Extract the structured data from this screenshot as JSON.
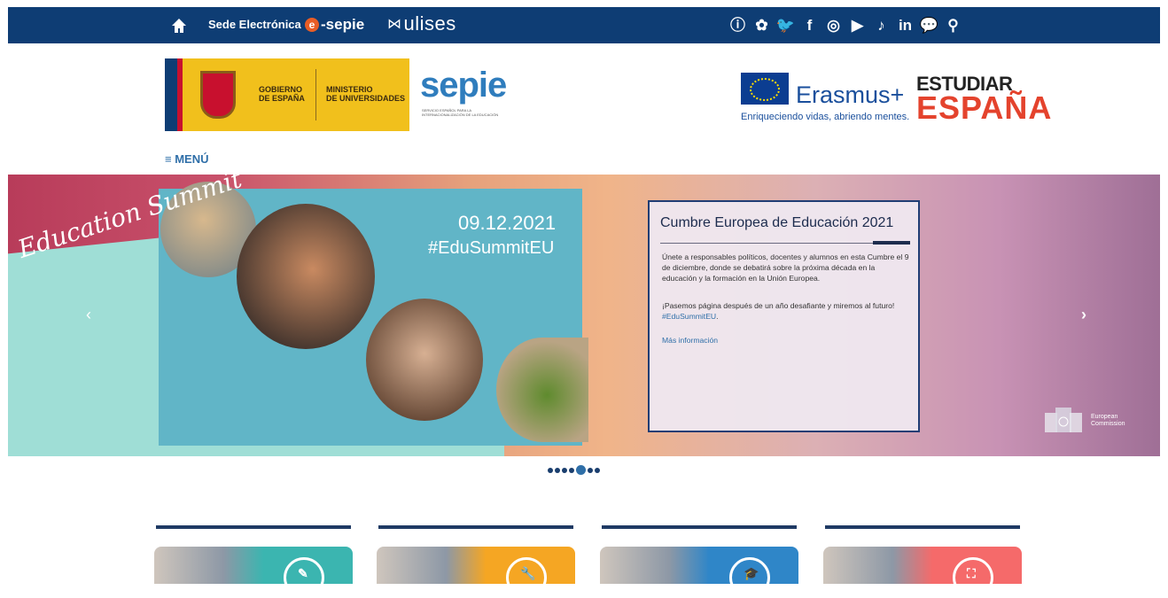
{
  "topbar": {
    "sede_label": "Sede Electrónica",
    "esepie_label": "sepie",
    "esepie_badge": "e",
    "esepie_dash": "-",
    "ulises_label": "ulises",
    "social": [
      {
        "name": "info-icon",
        "glyph": "ⓘ"
      },
      {
        "name": "sepie-icon",
        "glyph": "✿"
      },
      {
        "name": "twitter-icon",
        "glyph": "🐦"
      },
      {
        "name": "facebook-icon",
        "glyph": "f"
      },
      {
        "name": "instagram-icon",
        "glyph": "◎"
      },
      {
        "name": "youtube-icon",
        "glyph": "▶"
      },
      {
        "name": "tiktok-icon",
        "glyph": "♪"
      },
      {
        "name": "linkedin-icon",
        "glyph": "in"
      },
      {
        "name": "chat-icon",
        "glyph": "💬"
      },
      {
        "name": "search-icon",
        "glyph": "⚲"
      }
    ]
  },
  "logos": {
    "gobierno": "GOBIERNO\nDE ESPAÑA",
    "ministerio": "MINISTERIO\nDE UNIVERSIDADES",
    "sepie": "sepie",
    "sepie_sub": "SERVICIO ESPAÑOL PARA LA INTERNACIONALIZACIÓN DE LA EDUCACIÓN",
    "erasmus": "Erasmus+",
    "erasmus_tag": "Enriqueciendo vidas, abriendo mentes.",
    "estudiar": "ESTUDIAR",
    "espana": "ESPAÑA"
  },
  "nav": {
    "menu_label": "≡ MENÚ"
  },
  "slider": {
    "script_text": "Education Summit",
    "date": "09.12.2021",
    "hashtag": "#EduSummitEU",
    "prev": "‹",
    "next": "›",
    "card": {
      "title": "Cumbre Europea de Educación 2021",
      "p1": "Únete a responsables políticos, docentes y alumnos en esta Cumbre el 9 de diciembre, donde se debatirá sobre la próxima década en la educación y la formación en la Unión Europea.",
      "p2_text": "¡Pasemos página después de un año desafiante y miremos al futuro! ",
      "p2_tag": "#EduSummitEU",
      "p2_end": ".",
      "more": "Más información"
    },
    "ec_text": "European\nCommission",
    "dots_count": 7,
    "active_dot": 4
  },
  "bottom_cards": [
    {
      "color": "#3bb5b0",
      "glyph": "✎"
    },
    {
      "color": "#f5a623",
      "glyph": "🔧"
    },
    {
      "color": "#2f86c8",
      "glyph": "🎓"
    },
    {
      "color": "#f56a6a",
      "glyph": "⛶"
    }
  ]
}
